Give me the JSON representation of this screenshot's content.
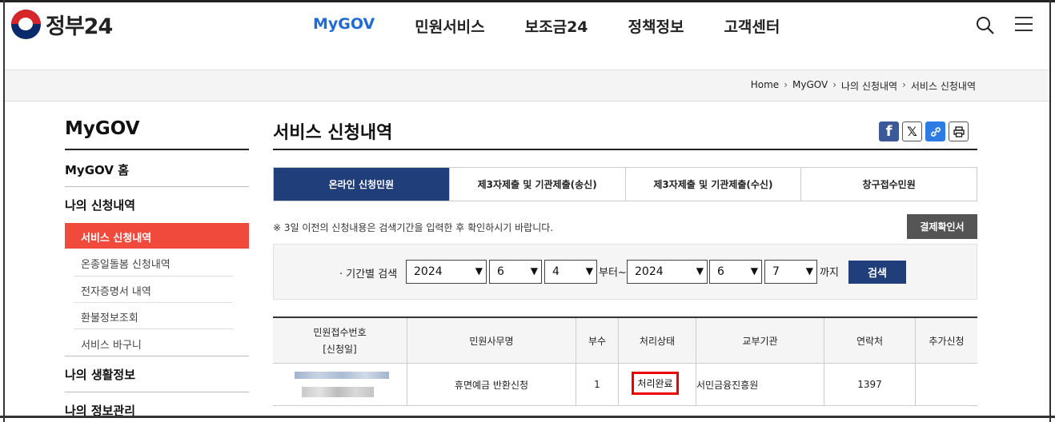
{
  "header": {
    "logo_text": "정부24",
    "nav": [
      "MyGOV",
      "민원서비스",
      "보조금24",
      "정책정보",
      "고객센터"
    ],
    "active_nav": "MyGOV"
  },
  "breadcrumb": [
    "Home",
    "MyGOV",
    "나의 신청내역",
    "서비스 신청내역"
  ],
  "sidebar": {
    "title": "MyGOV",
    "home": "MyGOV 홈",
    "section1": "나의 신청내역",
    "items": [
      "서비스 신청내역",
      "온종일돌봄 신청내역",
      "전자증명서 내역",
      "환불정보조회",
      "서비스 바구니"
    ],
    "section2": "나의 생활정보",
    "section3": "나의 정보관리"
  },
  "main": {
    "title": "서비스 신청내역",
    "share": {
      "facebook": "f",
      "x": "𝕏",
      "link": "🔗",
      "print": "🖶"
    },
    "tabs": [
      "온라인 신청민원",
      "제3자제출 및 기관제출(송신)",
      "제3자제출 및 기관제출(수신)",
      "창구접수민원"
    ],
    "notice": "※ 3일 이전의 신청내용은 검색기간을 입력한 후 확인하시기 바랍니다.",
    "confirm_button": "결제확인서",
    "search": {
      "label": "· 기간별 검색",
      "from_year": "2024",
      "from_month": "6",
      "from_day": "4",
      "from_suffix": "부터~",
      "to_year": "2024",
      "to_month": "6",
      "to_day": "7",
      "to_suffix": "까지",
      "button": "검색"
    },
    "table": {
      "headers": [
        "민원접수번호\n[신청일]",
        "민원사무명",
        "부수",
        "처리상태",
        "교부기관",
        "연락처",
        "추가신청"
      ],
      "header_line1": "민원접수번호",
      "header_line2": "[신청일]",
      "rows": [
        {
          "name": "휴면예금 반환신청",
          "count": "1",
          "status": "처리완료",
          "agency": "서민금융진흥원",
          "contact": "1397",
          "extra": ""
        }
      ]
    }
  }
}
